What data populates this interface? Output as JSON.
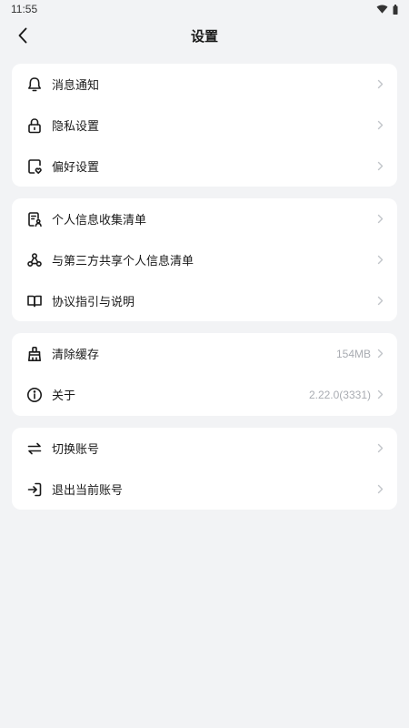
{
  "status_bar": {
    "time": "11:55"
  },
  "header": {
    "title": "设置"
  },
  "groups": [
    {
      "items": [
        {
          "label": "消息通知",
          "icon": "bell-icon"
        },
        {
          "label": "隐私设置",
          "icon": "lock-icon"
        },
        {
          "label": "偏好设置",
          "icon": "preference-icon"
        }
      ]
    },
    {
      "items": [
        {
          "label": "个人信息收集清单",
          "icon": "personal-info-list-icon"
        },
        {
          "label": "与第三方共享个人信息清单",
          "icon": "share-icon"
        },
        {
          "label": "协议指引与说明",
          "icon": "book-icon"
        }
      ]
    },
    {
      "items": [
        {
          "label": "清除缓存",
          "icon": "broom-icon",
          "value": "154MB"
        },
        {
          "label": "关于",
          "icon": "info-icon",
          "value": "2.22.0(3331)"
        }
      ]
    },
    {
      "items": [
        {
          "label": "切换账号",
          "icon": "switch-icon"
        },
        {
          "label": "退出当前账号",
          "icon": "logout-icon"
        }
      ]
    }
  ],
  "colors": {
    "background": "#f2f3f5",
    "card": "#ffffff",
    "text": "#1a1a1a",
    "secondary": "#a9acb2",
    "chevron": "#c2c5ca"
  }
}
